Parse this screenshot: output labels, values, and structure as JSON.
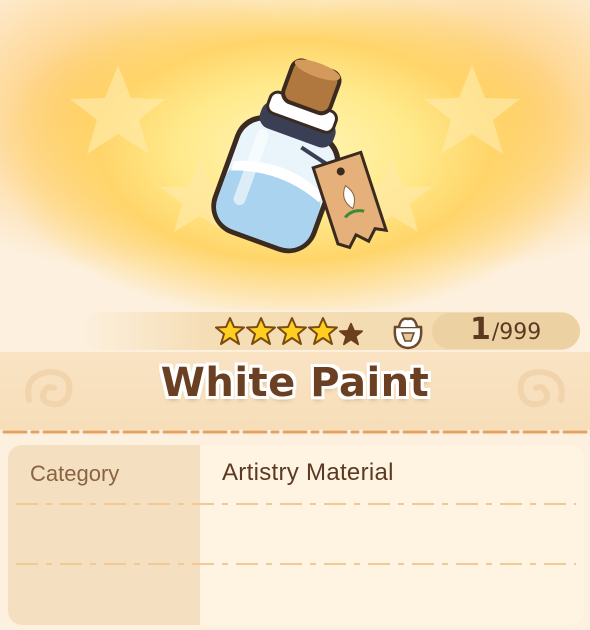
{
  "item": {
    "name": "White Paint",
    "rarity_stars": 4,
    "rarity_max": 5,
    "quantity_have": "1",
    "quantity_max": "/999"
  },
  "details": {
    "rows": [
      {
        "label": "Category",
        "value": "Artistry Material"
      },
      {
        "label": "",
        "value": ""
      },
      {
        "label": "",
        "value": ""
      }
    ]
  },
  "icons": {
    "item_image": "white-paint-bottle-icon",
    "star_filled": "star-filled-icon",
    "star_empty": "star-empty-icon",
    "inventory": "bag-icon"
  },
  "colors": {
    "title_text": "#6a3f22",
    "star_gold": "#ffcf1f",
    "star_empty": "#6b3f1e",
    "background": "#fdf0de"
  }
}
